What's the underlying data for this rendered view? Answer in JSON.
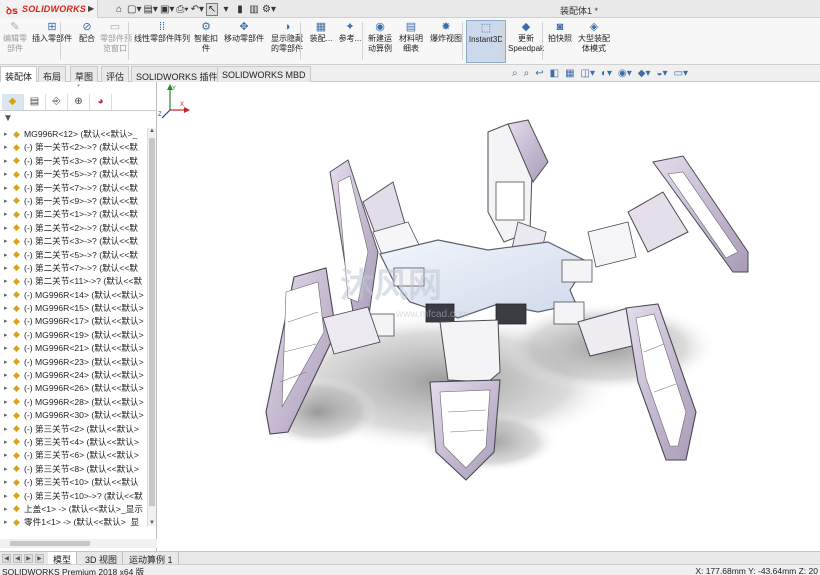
{
  "app": {
    "brand": "SOLIDWORKS",
    "document_title": "装配体1 *"
  },
  "quick_access": {
    "icons": [
      "home-icon",
      "new-document-icon",
      "open-icon",
      "save-icon",
      "print-icon",
      "undo-icon",
      "select-pointer-icon",
      "rebuild-icon",
      "file-properties-icon",
      "options-gear-icon"
    ]
  },
  "ribbon": {
    "buttons": [
      {
        "label1": "编辑零",
        "label2": "部件",
        "icon": "edit-component-icon",
        "disabled": true
      },
      {
        "label1": "插入零部件",
        "label2": "",
        "icon": "insert-component-icon",
        "disabled": false
      },
      {
        "label1": "配合",
        "label2": "",
        "icon": "mate-icon",
        "disabled": false
      },
      {
        "label1": "零部件预",
        "label2": "览窗口",
        "icon": "component-preview-icon",
        "disabled": true
      },
      {
        "label1": "线性零部件阵列",
        "label2": "",
        "icon": "linear-pattern-icon",
        "disabled": false
      },
      {
        "label1": "智能扣",
        "label2": "件",
        "icon": "smart-fastener-icon",
        "disabled": false
      },
      {
        "label1": "移动零部件",
        "label2": "",
        "icon": "move-component-icon",
        "disabled": false
      },
      {
        "label1": "显示隐藏",
        "label2": "的零部件",
        "icon": "show-hidden-icon",
        "disabled": false
      },
      {
        "label1": "装配...",
        "label2": "",
        "icon": "assembly-features-icon",
        "disabled": false
      },
      {
        "label1": "参考...",
        "label2": "",
        "icon": "reference-geometry-icon",
        "disabled": false
      },
      {
        "label1": "新建运",
        "label2": "动算例",
        "icon": "new-motion-study-icon",
        "disabled": false
      },
      {
        "label1": "材料明",
        "label2": "细表",
        "icon": "bill-of-materials-icon",
        "disabled": false
      },
      {
        "label1": "爆炸视图",
        "label2": "",
        "icon": "exploded-view-icon",
        "disabled": false
      },
      {
        "label1": "Instant3D",
        "label2": "",
        "icon": "instant3d-icon",
        "disabled": false,
        "active": true
      },
      {
        "label1": "更新",
        "label2": "Speedpak",
        "icon": "speedpak-icon",
        "disabled": false
      },
      {
        "label1": "拍快照",
        "label2": "",
        "icon": "snapshot-icon",
        "disabled": false
      },
      {
        "label1": "大型装配",
        "label2": "体模式",
        "icon": "large-assembly-icon",
        "disabled": false
      }
    ]
  },
  "command_tabs": [
    "装配体",
    "布局",
    "草图",
    "评估",
    "SOLIDWORKS 插件",
    "SOLIDWORKS MBD"
  ],
  "active_command_tab": "装配体",
  "headsup_icons": [
    "zoom-to-fit-icon",
    "zoom-area-icon",
    "previous-view-icon",
    "section-view-icon",
    "dynamic-annotation-icon",
    "view-orientation-icon",
    "display-style-icon",
    "hide-show-icon",
    "edit-appearance-icon",
    "apply-scene-icon",
    "view-settings-icon"
  ],
  "featuremanager": {
    "tabs": [
      "feature-manager-tab-icon",
      "property-manager-tab-icon",
      "configuration-manager-tab-icon",
      "dimxpert-tab-icon",
      "display-manager-tab-icon"
    ],
    "filter_icon": "filter-icon",
    "items": [
      {
        "text": "MG996R<12> (默认<<默认>_",
        "icon": "part-icon"
      },
      {
        "text": "(-) 第一关节<2>->? (默认<<默",
        "icon": "part-icon"
      },
      {
        "text": "(-) 第一关节<3>->? (默认<<默",
        "icon": "part-icon"
      },
      {
        "text": "(-) 第一关节<5>->? (默认<<默",
        "icon": "part-icon"
      },
      {
        "text": "(-) 第一关节<7>->? (默认<<默",
        "icon": "part-icon"
      },
      {
        "text": "(-) 第一关节<9>->? (默认<<默",
        "icon": "part-icon"
      },
      {
        "text": "(-) 第二关节<1>->? (默认<<默",
        "icon": "part-icon"
      },
      {
        "text": "(-) 第二关节<2>->? (默认<<默",
        "icon": "part-icon"
      },
      {
        "text": "(-) 第二关节<3>->? (默认<<默",
        "icon": "part-icon"
      },
      {
        "text": "(-) 第二关节<5>->? (默认<<默",
        "icon": "part-icon"
      },
      {
        "text": "(-) 第二关节<7>->? (默认<<默",
        "icon": "part-icon"
      },
      {
        "text": "(-) 第二关节<11>->? (默认<<默",
        "icon": "part-icon"
      },
      {
        "text": "(-) MG996R<14> (默认<<默认>",
        "icon": "part-icon"
      },
      {
        "text": "(-) MG996R<15> (默认<<默认>",
        "icon": "part-icon"
      },
      {
        "text": "(-) MG996R<17> (默认<<默认>",
        "icon": "part-icon"
      },
      {
        "text": "(-) MG996R<19> (默认<<默认>",
        "icon": "part-icon"
      },
      {
        "text": "(-) MG996R<21> (默认<<默认>",
        "icon": "part-icon"
      },
      {
        "text": "(-) MG996R<23> (默认<<默认>",
        "icon": "part-icon"
      },
      {
        "text": "(-) MG996R<24> (默认<<默认>",
        "icon": "part-icon"
      },
      {
        "text": "(-) MG996R<26> (默认<<默认>",
        "icon": "part-icon"
      },
      {
        "text": "(-) MG996R<28> (默认<<默认>",
        "icon": "part-icon"
      },
      {
        "text": "(-) MG996R<30> (默认<<默认>",
        "icon": "part-icon"
      },
      {
        "text": "(-) 第三关节<2> (默认<<默认>",
        "icon": "part-icon"
      },
      {
        "text": "(-) 第三关节<4> (默认<<默认>",
        "icon": "part-icon"
      },
      {
        "text": "(-) 第三关节<6> (默认<<默认>",
        "icon": "part-icon"
      },
      {
        "text": "(-) 第三关节<8> (默认<<默认>",
        "icon": "part-icon"
      },
      {
        "text": "(-) 第三关节<10> (默认<<默认",
        "icon": "part-icon"
      },
      {
        "text": "(-) 第三关节<10>->? (默认<<默",
        "icon": "part-icon"
      },
      {
        "text": "上盖<1> -> (默认<<默认>_显示",
        "icon": "part-icon"
      },
      {
        "text": "零件1<1> -> (默认<<默认>_显",
        "icon": "part-icon"
      },
      {
        "text": "配合",
        "icon": "mates-folder-icon"
      }
    ]
  },
  "bottom_tabs": [
    "模型",
    "3D 视图",
    "运动算例 1"
  ],
  "active_bottom_tab": "模型",
  "watermark": {
    "main": "沐风网",
    "url": "www.mfcad.com"
  },
  "status": {
    "product": "SOLIDWORKS Premium 2018 x64 版",
    "coords": "X: 177.68mm Y: -43.64mm Z: 20"
  },
  "colors": {
    "part_lavender": "#cdc4d8",
    "part_white": "#f4f4f6",
    "plate_blue": "#e6ecf6",
    "servo_dark": "#3a3c44",
    "brand_red": "#d9261c",
    "shadow": "#9b9b9b"
  }
}
